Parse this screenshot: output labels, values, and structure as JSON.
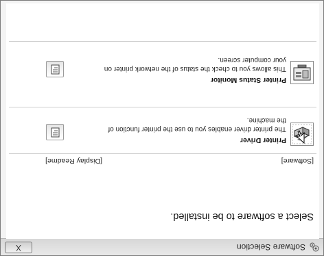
{
  "window": {
    "title": "Software Selection",
    "close_label": "X"
  },
  "main": {
    "heading": "Select a software to be installed.",
    "columns": {
      "software": "[Software]",
      "readme": "[Display Readme]"
    },
    "items": [
      {
        "title": "Printer Driver",
        "description": "The printer driver enables you to use the printer function of the machine.",
        "icon": "printer-icon"
      },
      {
        "title": "Printer Status Monitor",
        "description": "This allows you to check the status of the network printer on your computer screen.",
        "icon": "status-monitor-icon"
      }
    ]
  }
}
